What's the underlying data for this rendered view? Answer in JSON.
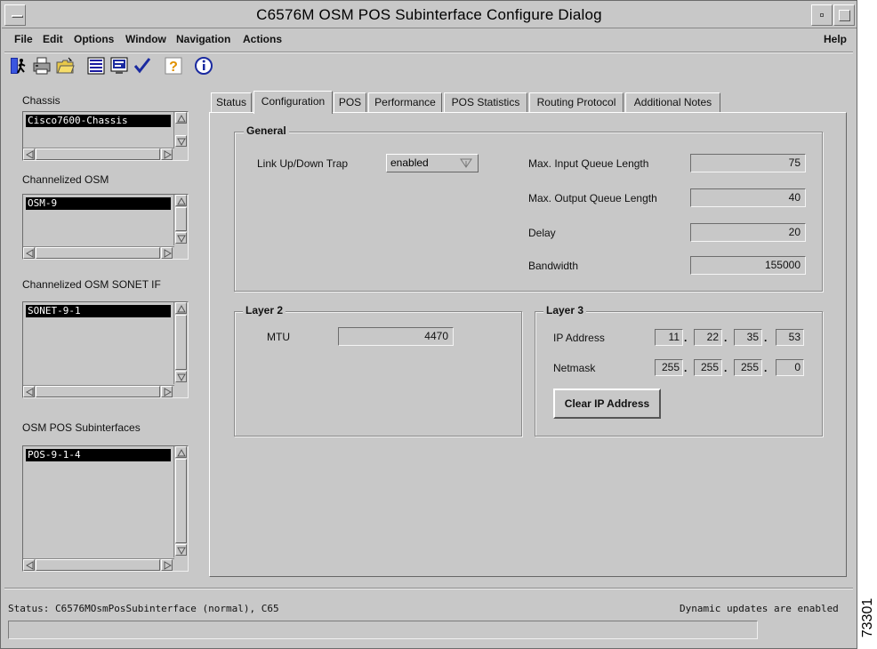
{
  "window": {
    "title": "C6576M OSM POS Subinterface Configure Dialog"
  },
  "menubar": {
    "items": [
      {
        "label": "File"
      },
      {
        "label": "Edit"
      },
      {
        "label": "Options"
      },
      {
        "label": "Window"
      },
      {
        "label": "Navigation"
      },
      {
        "label": "Actions"
      }
    ],
    "help": "Help"
  },
  "toolbar": {
    "icons": [
      "exit-icon",
      "print-icon",
      "open-folder-icon",
      "list-icon",
      "monitor-icon",
      "checkmark-icon",
      "help-question-icon",
      "info-icon"
    ]
  },
  "sidebar": {
    "chassis": {
      "label": "Chassis",
      "selected": "Cisco7600-Chassis"
    },
    "channelized_osm": {
      "label": "Channelized OSM",
      "selected": "OSM-9"
    },
    "channelized_osm_sonet_if": {
      "label": "Channelized OSM SONET IF",
      "selected": "SONET-9-1"
    },
    "osm_pos_subinterfaces": {
      "label": "OSM POS Subinterfaces",
      "selected": "POS-9-1-4"
    }
  },
  "tabs": [
    {
      "label": "Status"
    },
    {
      "label": "Configuration",
      "active": true
    },
    {
      "label": "POS"
    },
    {
      "label": "Performance"
    },
    {
      "label": "POS Statistics"
    },
    {
      "label": "Routing Protocol"
    },
    {
      "label": "Additional Notes"
    }
  ],
  "general": {
    "title": "General",
    "link_trap_label": "Link Up/Down Trap",
    "link_trap_value": "enabled",
    "max_input_queue_label": "Max. Input Queue Length",
    "max_input_queue_value": "75",
    "max_output_queue_label": "Max. Output Queue Length",
    "max_output_queue_value": "40",
    "delay_label": "Delay",
    "delay_value": "20",
    "bandwidth_label": "Bandwidth",
    "bandwidth_value": "155000"
  },
  "layer2": {
    "title": "Layer 2",
    "mtu_label": "MTU",
    "mtu_value": "4470"
  },
  "layer3": {
    "title": "Layer 3",
    "ip_label": "IP Address",
    "ip": [
      "11",
      "22",
      "35",
      "53"
    ],
    "netmask_label": "Netmask",
    "netmask": [
      "255",
      "255",
      "255",
      "0"
    ],
    "clear_button": "Clear IP Address"
  },
  "statusbar": {
    "status": "Status: C6576MOsmPosSubinterface (normal), C65",
    "updates": "Dynamic updates are enabled"
  },
  "figure_id": "73301"
}
